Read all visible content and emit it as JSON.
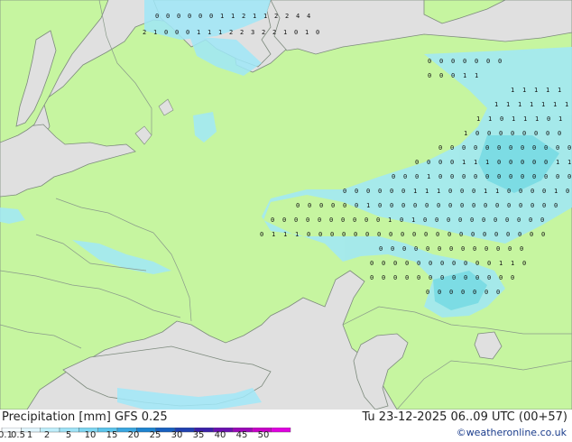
{
  "map": {
    "labels": [
      "0",
      "0",
      "0",
      "0",
      "0",
      "0",
      "1",
      "1",
      "2",
      "1",
      "1",
      "2",
      "2",
      "4",
      "4",
      "2",
      "1",
      "0",
      "0",
      "0",
      "1",
      "1",
      "1",
      "2",
      "2",
      "3",
      "2",
      "2",
      "1",
      "0",
      "1",
      "0",
      "0",
      "0",
      "0",
      "0",
      "0",
      "0",
      "0",
      "0",
      "0",
      "0",
      "1",
      "1",
      "1",
      "1",
      "1",
      "1",
      "1",
      "1",
      "1",
      "1",
      "1",
      "1",
      "1",
      "1",
      "1",
      "1",
      "0",
      "1",
      "1",
      "1",
      "0",
      "1",
      "1",
      "0",
      "0",
      "0",
      "0",
      "0",
      "0",
      "0",
      "0",
      "0",
      "0",
      "0",
      "0",
      "0",
      "0",
      "0",
      "0",
      "0",
      "0",
      "0",
      "0",
      "0",
      "0",
      "0",
      "0",
      "1",
      "1",
      "1",
      "0",
      "0",
      "0",
      "0",
      "0",
      "1",
      "1",
      "0",
      "0",
      "0",
      "1",
      "0",
      "0",
      "0",
      "0",
      "0",
      "0",
      "0",
      "0",
      "0",
      "0",
      "0",
      "0",
      "0",
      "0",
      "0",
      "0",
      "0",
      "0",
      "1",
      "1",
      "1",
      "0",
      "0",
      "0",
      "1",
      "1",
      "0",
      "0",
      "0",
      "0",
      "1",
      "0",
      "0",
      "0",
      "0",
      "0",
      "0",
      "0",
      "1",
      "0",
      "0",
      "0",
      "0",
      "0",
      "0",
      "0",
      "0",
      "0",
      "0",
      "0",
      "0",
      "0",
      "0",
      "0",
      "0",
      "0",
      "0",
      "0",
      "0",
      "0",
      "0",
      "0",
      "0",
      "0",
      "0",
      "1",
      "0",
      "1",
      "0",
      "0",
      "0",
      "0",
      "0",
      "0",
      "0",
      "0",
      "0",
      "0",
      "0",
      "0",
      "1",
      "1",
      "1",
      "0",
      "0",
      "0",
      "0",
      "0",
      "0",
      "0",
      "0",
      "0",
      "0",
      "0",
      "0",
      "0",
      "0",
      "0",
      "0",
      "0",
      "0",
      "0",
      "0",
      "0",
      "0",
      "0",
      "0",
      "0",
      "0",
      "0",
      "0",
      "0",
      "0",
      "0",
      "0",
      "0",
      "0",
      "0",
      "0",
      "0",
      "0",
      "0",
      "0",
      "0",
      "0",
      "0",
      "0",
      "0",
      "1",
      "1",
      "0",
      "0",
      "0",
      "0",
      "0",
      "0",
      "0",
      "0",
      "0",
      "0",
      "0",
      "0",
      "0",
      "0",
      "0",
      "0",
      "0",
      "0",
      "0",
      "0",
      "0",
      "0",
      "0",
      "0",
      "0",
      "1"
    ],
    "colors": {
      "land": "#c6f5a0",
      "sea": "#e0e0e0",
      "border": "#8a9a8a",
      "coast": "#7d8a7d",
      "precip_light": "#a0e8f8",
      "precip_med": "#70d8f0"
    }
  },
  "footer": {
    "legend_title": "Precipitation [mm] GFS 0.25",
    "run_info": "Tu 23-12-2025 06..09 UTC (00+57)",
    "attribution": "©weatheronline.co.uk",
    "scale_ticks": [
      "0.1",
      "0.5",
      "1",
      "2",
      "5",
      "10",
      "15",
      "20",
      "25",
      "30",
      "35",
      "40",
      "45",
      "50"
    ],
    "scale_colors": [
      "#f5fbff",
      "#dff5fd",
      "#bfeefb",
      "#9fe3f7",
      "#7ed6f2",
      "#5cc5ec",
      "#3aa6e0",
      "#1e84d0",
      "#1860c0",
      "#2040b0",
      "#3a20a8",
      "#6a10b0",
      "#9a08b8",
      "#c800c8",
      "#e000e0"
    ]
  }
}
